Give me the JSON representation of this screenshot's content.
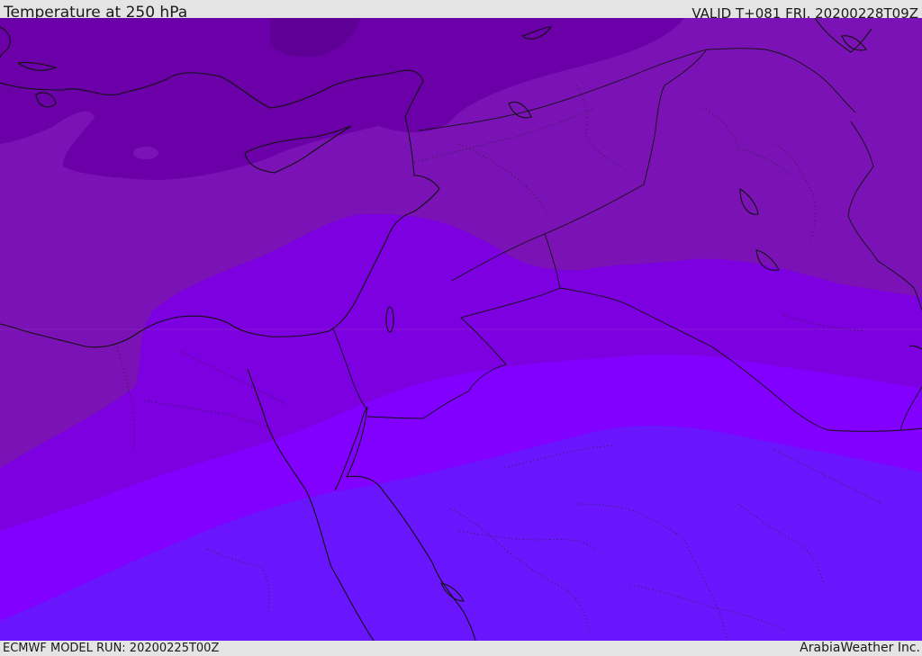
{
  "header": {
    "title": "Temperature at 250 hPa",
    "valid": "VALID T+081 FRI. 20200228T09Z"
  },
  "footer": {
    "model_run": "ECMWF MODEL RUN: 20200225T00Z",
    "brand": "ArabiaWeather Inc."
  },
  "map": {
    "field": "Temperature at 250 hPa",
    "fill_colors": [
      "#5e0096",
      "#6b00a8",
      "#7a12b6",
      "#7c00e0",
      "#8100ff",
      "#6916ff"
    ]
  }
}
